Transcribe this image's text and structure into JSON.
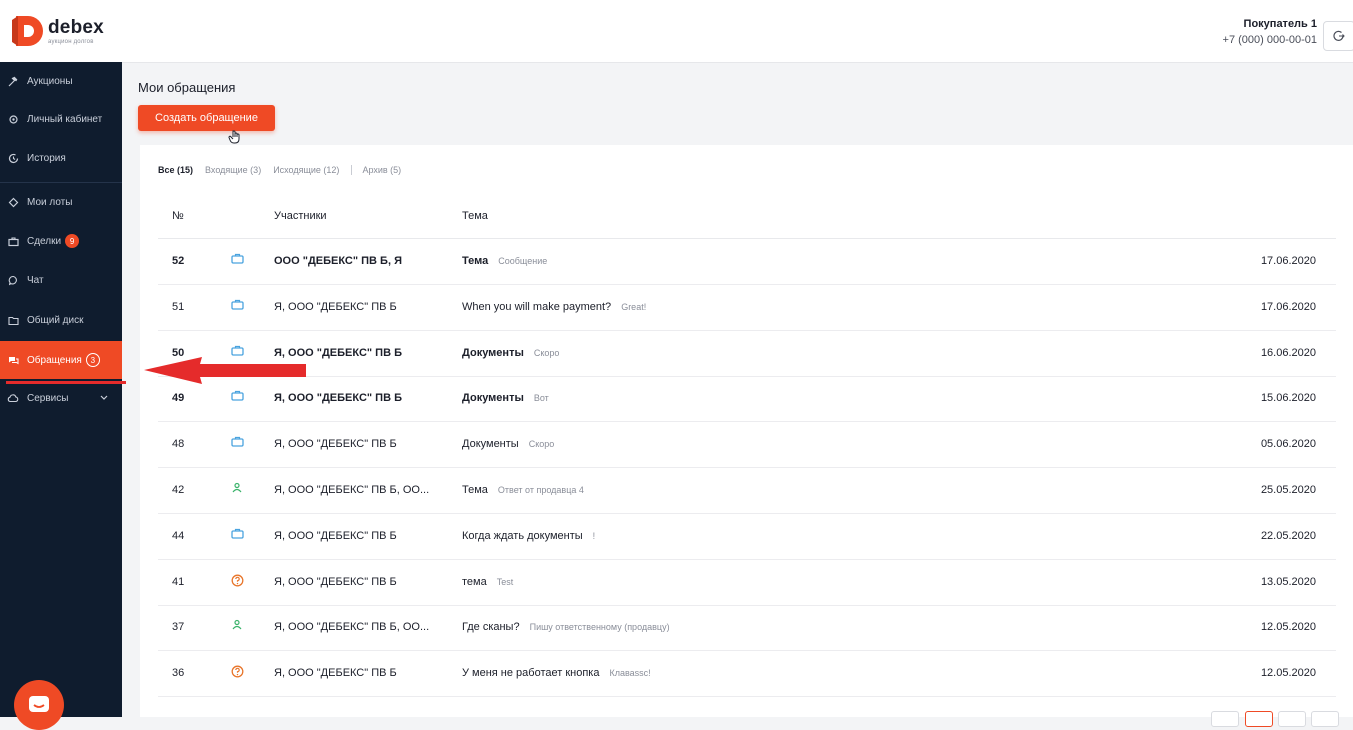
{
  "brand": {
    "name": "debex",
    "tagline": "аукцион долгов"
  },
  "user": {
    "name": "Покупатель 1",
    "phone": "+7 (000) 000-00-01"
  },
  "sidebar": {
    "items": [
      {
        "label": "Аукционы",
        "icon": "gavel-icon"
      },
      {
        "label": "Личный кабинет",
        "icon": "gear-icon"
      },
      {
        "label": "История",
        "icon": "history-icon"
      },
      {
        "label": "Мои лоты",
        "icon": "diamond-icon"
      },
      {
        "label": "Сделки",
        "icon": "briefcase-icon",
        "badge": "9"
      },
      {
        "label": "Чат",
        "icon": "chat-icon"
      },
      {
        "label": "Общий диск",
        "icon": "folder-icon"
      },
      {
        "label": "Обращения",
        "icon": "messages-icon",
        "badge": "3",
        "active": true
      },
      {
        "label": "Сервисы",
        "icon": "cloud-icon"
      }
    ]
  },
  "main": {
    "title": "Мои обращения",
    "create_label": "Создать обращение",
    "filters": [
      {
        "label": "Все (15)",
        "active": true
      },
      {
        "label": "Входящие (3)"
      },
      {
        "label": "Исходящие (12)"
      },
      {
        "label": "Архив (5)"
      }
    ],
    "columns": {
      "id": "№",
      "participants": "Участники",
      "topic": "Тема"
    },
    "rows": [
      {
        "id": "52",
        "type": "briefcase-icon",
        "participants": "ООО \"ДЕБЕКС\" ПВ Б, Я",
        "topic": "Тема",
        "preview": "Сообщение",
        "date": "17.06.2020",
        "unread": true
      },
      {
        "id": "51",
        "type": "briefcase-icon",
        "participants": "Я, ООО \"ДЕБЕКС\" ПВ Б",
        "topic": "When you will make payment?",
        "preview": "Great!",
        "date": "17.06.2020",
        "unread": false
      },
      {
        "id": "50",
        "type": "briefcase-icon",
        "participants": "Я, ООО \"ДЕБЕКС\" ПВ Б",
        "topic": "Документы",
        "preview": "Скоро",
        "date": "16.06.2020",
        "unread": true
      },
      {
        "id": "49",
        "type": "briefcase-icon",
        "participants": "Я, ООО \"ДЕБЕКС\" ПВ Б",
        "topic": "Документы",
        "preview": "Вот",
        "date": "15.06.2020",
        "unread": true
      },
      {
        "id": "48",
        "type": "briefcase-icon",
        "participants": "Я, ООО \"ДЕБЕКС\" ПВ Б",
        "topic": "Документы",
        "preview": "Скоро",
        "date": "05.06.2020",
        "unread": false
      },
      {
        "id": "42",
        "type": "person-icon",
        "participants": "Я, ООО \"ДЕБЕКС\" ПВ Б, ОО...",
        "topic": "Тема",
        "preview": "Ответ от продавца 4",
        "date": "25.05.2020",
        "unread": false
      },
      {
        "id": "44",
        "type": "briefcase-icon",
        "participants": "Я, ООО \"ДЕБЕКС\" ПВ Б",
        "topic": "Когда ждать документы",
        "preview": "!",
        "date": "22.05.2020",
        "unread": false
      },
      {
        "id": "41",
        "type": "question-icon",
        "participants": "Я, ООО \"ДЕБЕКС\" ПВ Б",
        "topic": "тема",
        "preview": "Test",
        "date": "13.05.2020",
        "unread": false
      },
      {
        "id": "37",
        "type": "person-icon",
        "participants": "Я, ООО \"ДЕБЕКС\" ПВ Б, ОО...",
        "topic": "Где сканы?",
        "preview": "Пишу ответственному (продавцу)",
        "date": "12.05.2020",
        "unread": false
      },
      {
        "id": "36",
        "type": "question-icon",
        "participants": "Я, ООО \"ДЕБЕКС\" ПВ Б",
        "topic": "У меня не работает кнопка",
        "preview": "Клаваssс!",
        "date": "12.05.2020",
        "unread": false
      }
    ]
  },
  "colors": {
    "accent": "#ef4a25",
    "sidebar_bg": "#0f1c2e",
    "briefcase": "#4aa3df",
    "person": "#3bb36b",
    "question": "#e8762c",
    "annotation": "#e52b2b"
  }
}
